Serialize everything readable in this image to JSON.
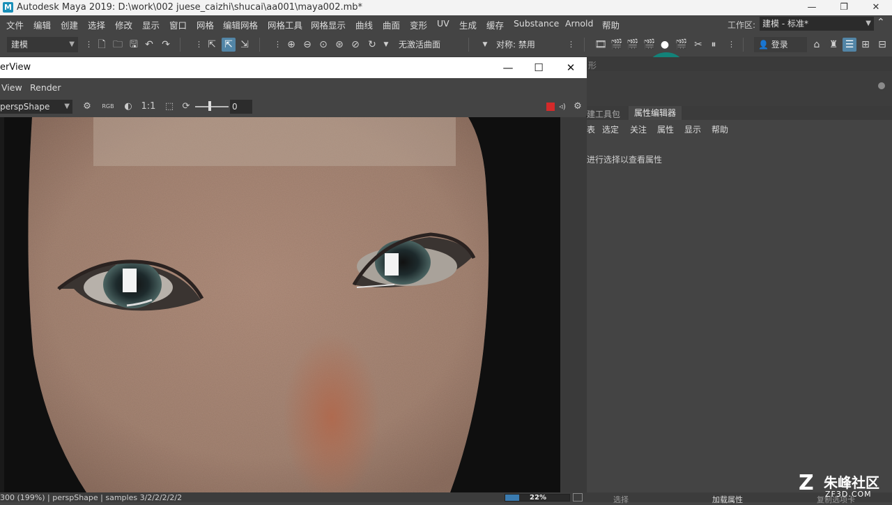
{
  "app": {
    "logo_letter": "M",
    "title": "Autodesk Maya 2019: D:\\work\\002 juese_caizhi\\shucai\\aa001\\maya002.mb*",
    "min": "—",
    "restore": "❐",
    "close": "✕"
  },
  "menubar": {
    "items": [
      "文件",
      "编辑",
      "创建",
      "选择",
      "修改",
      "显示",
      "窗口",
      "网格",
      "编辑网格",
      "网格工具",
      "网格显示",
      "曲线",
      "曲面",
      "变形",
      "UV",
      "生成",
      "缓存",
      "Substance",
      "Arnold",
      "帮助"
    ],
    "workspace_label": "工作区:",
    "workspace_value": "建模 - 标准*"
  },
  "toolbar": {
    "mode_select": "建模",
    "live_surface": "无激活曲面",
    "symmetry": "对称: 禁用",
    "login": "登录"
  },
  "right_panel": {
    "strip_text": "形",
    "tabs": [
      "建工具包",
      "属性编辑器"
    ],
    "active_tab": "属性编辑器",
    "menu": [
      "表",
      "选定",
      "关注",
      "属性",
      "显示",
      "帮助"
    ],
    "hint": "进行选择以查看属性",
    "bottom": [
      "选择",
      "加载属性",
      "复制选项卡"
    ]
  },
  "render_view": {
    "title": "erView",
    "menu": [
      "View",
      "Render"
    ],
    "camera": "perspShape",
    "ratio": "1:1",
    "exposure": "0",
    "status": "300 (199%)  |  perspShape  |  samples 3/2/2/2/2/2",
    "progress_text": "22%",
    "progress": 0.22
  },
  "watermark": {
    "mark": "Z",
    "cn": "朱峰社区",
    "en": "ZF3D.COM"
  }
}
